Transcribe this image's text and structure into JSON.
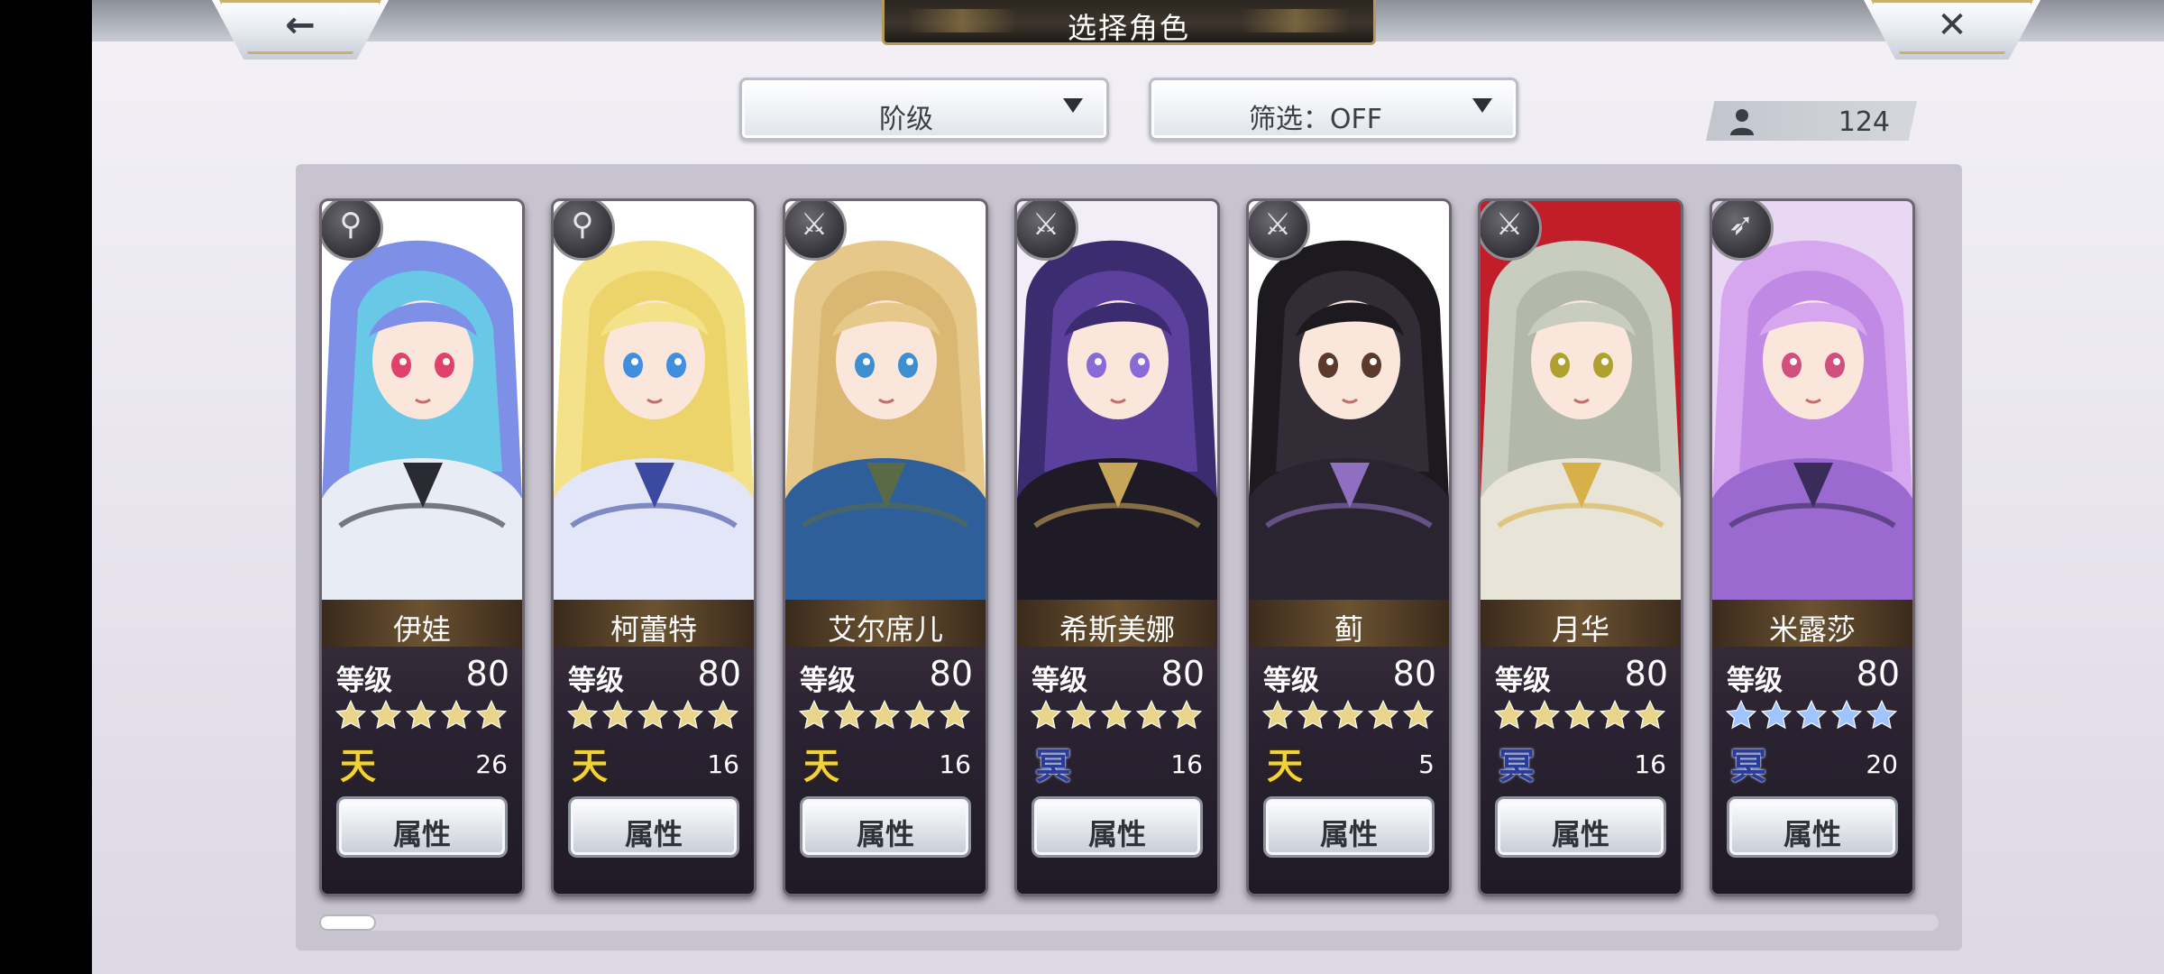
{
  "header": {
    "title": "选择角色",
    "back_icon": "←",
    "close_icon": "✕"
  },
  "filters": {
    "rank_label": "阶级",
    "filter_label": "筛选：OFF"
  },
  "roster_count": "124",
  "colors": {
    "gold_rank": "#f2d23a",
    "blue_rank": "#2a3c9a",
    "gold_star": "#e8d58a",
    "blue_star": "#9fc4ff"
  },
  "scroll": {
    "fraction": 0.035
  },
  "characters": [
    {
      "name": "伊娃",
      "level_label": "等级",
      "level": "80",
      "stars": 5,
      "star_color": "gold",
      "rank_glyph": "天",
      "rank_type": "gold",
      "rank_num": "26",
      "attr_label": "属性",
      "weapon": "staff-icon",
      "weapon_glyph": "⚲",
      "palette": {
        "bg": "#ffffff",
        "hair": "#7d8fe6",
        "hair2": "#5fe0e6",
        "cloth": "#e8ecf5",
        "eye": "#e0406a",
        "accent": "#2a2a33"
      }
    },
    {
      "name": "柯蕾特",
      "level_label": "等级",
      "level": "80",
      "stars": 5,
      "star_color": "gold",
      "rank_glyph": "天",
      "rank_type": "gold",
      "rank_num": "16",
      "attr_label": "属性",
      "weapon": "staff-icon",
      "weapon_glyph": "⚲",
      "palette": {
        "bg": "#ffffff",
        "hair": "#f3e28a",
        "hair2": "#e8cf5c",
        "cloth": "#e3e6f7",
        "eye": "#3f8ee0",
        "accent": "#3b4aa0"
      }
    },
    {
      "name": "艾尔席儿",
      "level_label": "等级",
      "level": "80",
      "stars": 5,
      "star_color": "gold",
      "rank_glyph": "天",
      "rank_type": "gold",
      "rank_num": "16",
      "attr_label": "属性",
      "weapon": "sword-icon",
      "weapon_glyph": "⚔",
      "palette": {
        "bg": "#ffffff",
        "hair": "#e6c98a",
        "hair2": "#d4b16a",
        "cloth": "#2f5f9a",
        "eye": "#3d8fd0",
        "accent": "#5a6a48"
      }
    },
    {
      "name": "希斯美娜",
      "level_label": "等级",
      "level": "80",
      "stars": 5,
      "star_color": "gold",
      "rank_glyph": "冥",
      "rank_type": "blue",
      "rank_num": "16",
      "attr_label": "属性",
      "weapon": "sword-icon",
      "weapon_glyph": "⚔",
      "palette": {
        "bg": "#f2eef8",
        "hair": "#3a2c6e",
        "hair2": "#6a4ab0",
        "cloth": "#1e1a26",
        "eye": "#8a6ad8",
        "accent": "#c7a65a"
      }
    },
    {
      "name": "蓟",
      "level_label": "等级",
      "level": "80",
      "stars": 5,
      "star_color": "gold",
      "rank_glyph": "天",
      "rank_type": "gold",
      "rank_num": "5",
      "attr_label": "属性",
      "weapon": "katana-icon",
      "weapon_glyph": "⚔",
      "palette": {
        "bg": "#ffffff",
        "hair": "#1c1a1e",
        "hair2": "#3a3540",
        "cloth": "#2a2430",
        "eye": "#5a3a2a",
        "accent": "#8e6fc0"
      }
    },
    {
      "name": "月华",
      "level_label": "等级",
      "level": "80",
      "stars": 5,
      "star_color": "gold",
      "rank_glyph": "冥",
      "rank_type": "blue",
      "rank_num": "16",
      "attr_label": "属性",
      "weapon": "katana-icon",
      "weapon_glyph": "⚔",
      "palette": {
        "bg": "#c21e2a",
        "hair": "#c9cdbf",
        "hair2": "#a9b09e",
        "cloth": "#e9e4d8",
        "eye": "#b0a030",
        "accent": "#d8b04a"
      }
    },
    {
      "name": "米露莎",
      "level_label": "等级",
      "level": "80",
      "stars": 5,
      "star_color": "blue",
      "rank_glyph": "冥",
      "rank_type": "blue",
      "rank_num": "20",
      "attr_label": "属性",
      "weapon": "arrow-icon",
      "weapon_glyph": "➶",
      "palette": {
        "bg": "#e9d8f4",
        "hair": "#d6a6ef",
        "hair2": "#b77ee0",
        "cloth": "#9a6ad0",
        "eye": "#d14f7e",
        "accent": "#3a2c5a"
      }
    }
  ]
}
